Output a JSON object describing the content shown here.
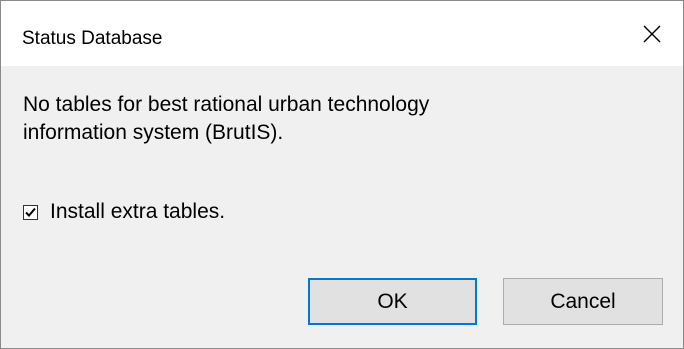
{
  "window": {
    "title": "Status Database"
  },
  "message": {
    "line1": "No tables for best rational urban technology",
    "line2": "information system (BrutIS)."
  },
  "option": {
    "label": "Install extra tables.",
    "checked": true
  },
  "buttons": {
    "ok_label": "OK",
    "cancel_label": "Cancel"
  },
  "colors": {
    "title_bar": "#ffffff",
    "dialog_bg": "#f0f0f0",
    "default_button_border": "#0078d7"
  }
}
